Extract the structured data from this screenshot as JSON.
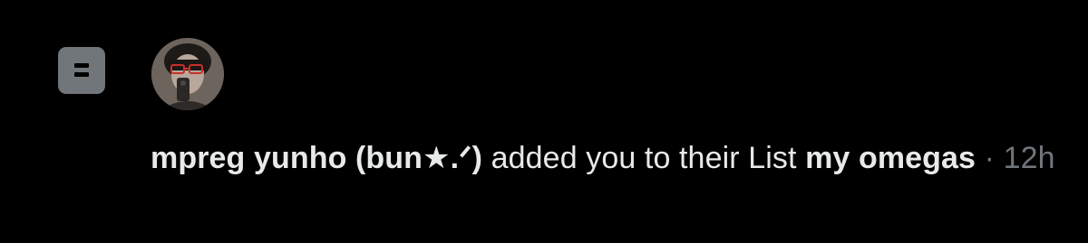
{
  "notification": {
    "type_icon": "list-icon",
    "avatar": "user-avatar",
    "user_name": "mpreg yunho (bun★.ᐟ)",
    "action_text": " added you to their List ",
    "list_name": "my omegas",
    "separator": " · ",
    "time": "12h",
    "colors": {
      "background": "#000000",
      "text": "#e7e9ea",
      "muted": "#71767b"
    }
  }
}
